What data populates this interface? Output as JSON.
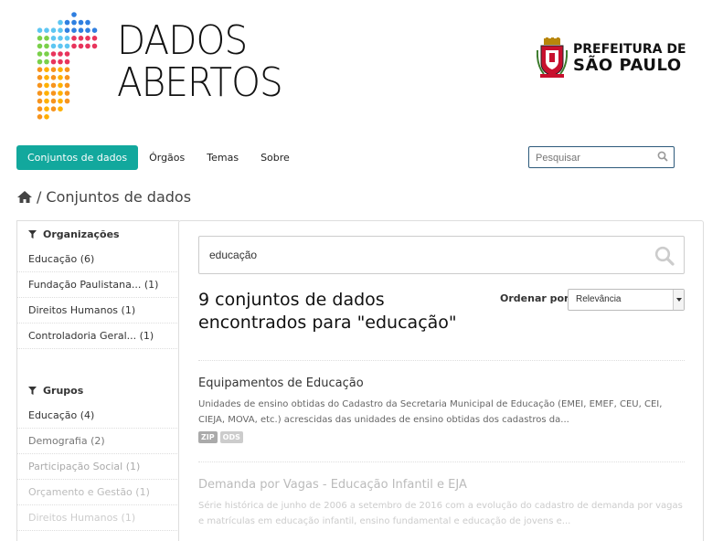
{
  "logo": {
    "line1": "DADOS",
    "line2": "ABERTOS"
  },
  "prefeitura": {
    "line1": "PREFEITURA DE",
    "line2": "SÃO PAULO"
  },
  "nav": {
    "items": [
      "Conjuntos de dados",
      "Órgãos",
      "Temas",
      "Sobre"
    ],
    "search_placeholder": "Pesquisar"
  },
  "breadcrumb": {
    "separator": "/",
    "current": "Conjuntos de dados"
  },
  "sidebar": {
    "organizations": {
      "heading": "Organizações",
      "items": [
        "Educação (6)",
        "Fundação Paulistana... (1)",
        "Direitos Humanos (1)",
        "Controladoria Geral... (1)"
      ]
    },
    "groups": {
      "heading": "Grupos",
      "items": [
        "Educação (4)",
        "Demografia (2)",
        "Participação Social (1)",
        "Orçamento e Gestão (1)",
        "Direitos Humanos (1)"
      ]
    }
  },
  "main": {
    "search_value": "educação",
    "results_title": "9 conjuntos de dados encontrados para \"educação\"",
    "sort_label": "Ordenar por:",
    "sort_value": "Relevância",
    "datasets": [
      {
        "title": "Equipamentos de Educação",
        "notes": "Unidades de ensino obtidas do Cadastro da Secretaria Municipal de Educação (EMEI, EMEF, CEU, CEI, CIEJA, MOVA, etc.) acrescidas das unidades de ensino obtidas dos cadastros da...",
        "formats": [
          "ZIP",
          "ODS"
        ]
      },
      {
        "title": "Demanda por Vagas - Educação Infantil e EJA",
        "notes": "Série histórica de junho de 2006 a setembro de 2016 com a evolução do cadastro de demanda por vagas e matrículas em educação infantil, ensino fundamental e educação de jovens e..."
      }
    ]
  },
  "colors": {
    "accent": "#12a89d",
    "search_border": "#2d5a7b"
  }
}
